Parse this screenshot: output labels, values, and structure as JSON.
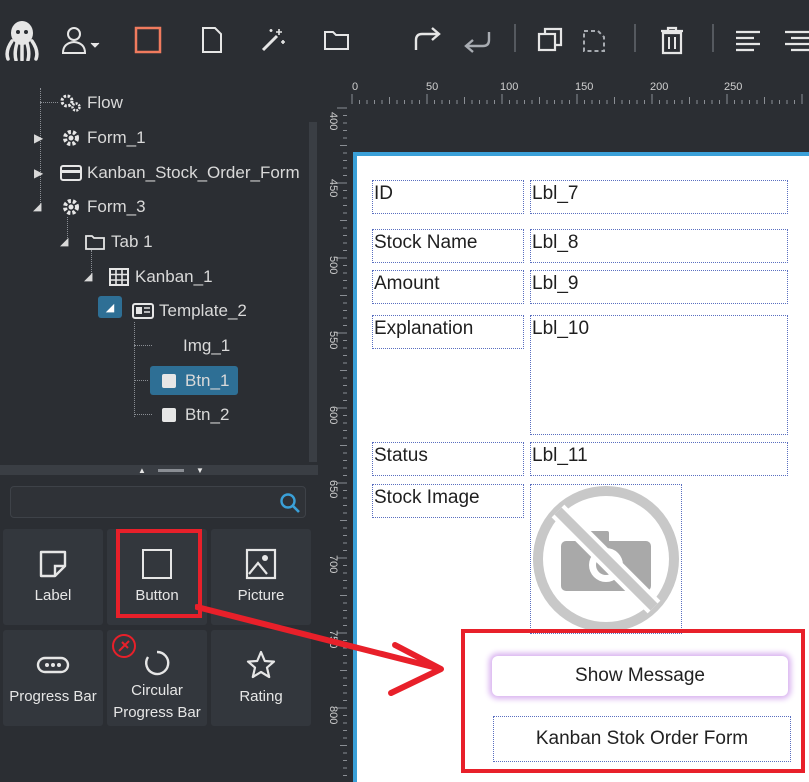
{
  "tree": {
    "nodes": [
      {
        "label": "Flow"
      },
      {
        "label": "Form_1"
      },
      {
        "label": "Kanban_Stock_Order_Form"
      },
      {
        "label": "Form_3"
      },
      {
        "label": "Tab 1"
      },
      {
        "label": "Kanban_1"
      },
      {
        "label": "Template_2"
      },
      {
        "label": "Img_1"
      },
      {
        "label": "Btn_1"
      },
      {
        "label": "Btn_2"
      }
    ]
  },
  "palette": {
    "label": "Label",
    "button": "Button",
    "picture": "Picture",
    "progress_bar": "Progress Bar",
    "circular_line1": "Circular",
    "circular_line2": "Progress Bar",
    "rating": "Rating"
  },
  "ruler": {
    "h": [
      "0",
      "50",
      "100",
      "150",
      "200",
      "250"
    ],
    "v": [
      "400",
      "450",
      "500",
      "550",
      "600",
      "650",
      "700",
      "750",
      "800"
    ]
  },
  "form": {
    "id_label": "ID",
    "id_value": "Lbl_7",
    "stock_name_label": "Stock Name",
    "stock_name_value": "Lbl_8",
    "amount_label": "Amount",
    "amount_value": "Lbl_9",
    "explanation_label": "Explanation",
    "explanation_value": "Lbl_10",
    "status_label": "Status",
    "status_value": "Lbl_11",
    "stock_image_label": "Stock Image",
    "show_message": "Show Message",
    "kanban_button": "Kanban Stok Order Form"
  },
  "colors": {
    "accent": "#3aa0d8",
    "highlight": "#e8202a",
    "selected": "#2e6f95"
  }
}
